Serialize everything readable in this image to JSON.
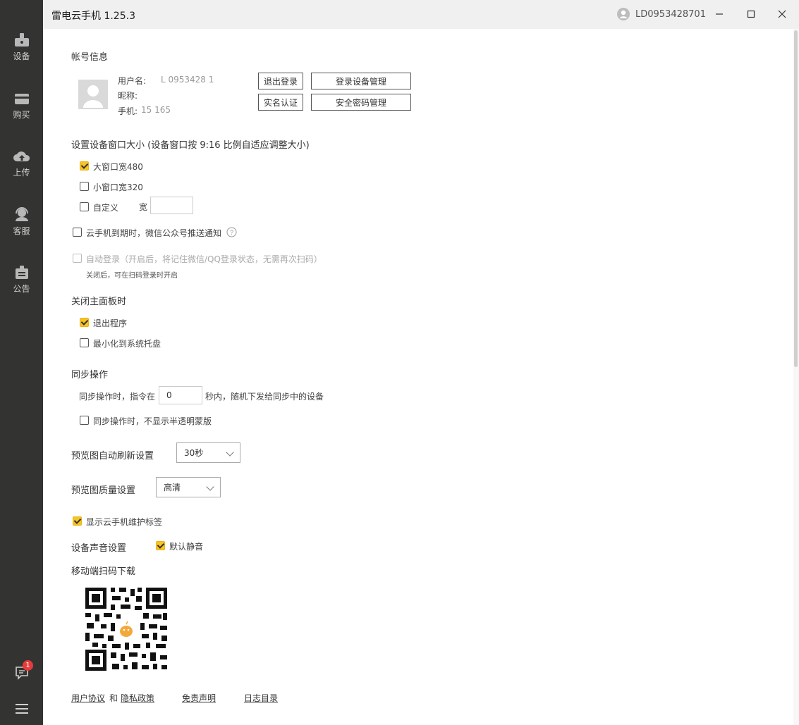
{
  "app": {
    "title": "雷电云手机 1.25.3",
    "user_id": "LD0953428701"
  },
  "nav": [
    {
      "label": "设备",
      "icon": "device-icon"
    },
    {
      "label": "购买",
      "icon": "card-icon"
    },
    {
      "label": "上传",
      "icon": "cloud-upload-icon"
    },
    {
      "label": "客服",
      "icon": "headset-icon"
    },
    {
      "label": "公告",
      "icon": "bulletin-icon"
    }
  ],
  "nav_bottom": {
    "badge": "1"
  },
  "account": {
    "section_title": "帐号信息",
    "username_label": "用户名:",
    "username_value": "L  0953428   1",
    "nickname_label": "昵称:",
    "phone_label": "手机:",
    "phone_value": "15          165",
    "logout": "退出登录",
    "device_mgmt": "登录设备管理",
    "realname": "实名认证",
    "password_mgmt": "安全密码管理"
  },
  "window_size": {
    "title": "设置设备窗口大小 (设备窗口按 9:16 比例自适应调整大小)",
    "large": "大窗口宽480",
    "small": "小窗口宽320",
    "custom": "自定义",
    "width_label": "宽",
    "width_value": ""
  },
  "wechat_notify": "云手机到期时，微信公众号推送通知",
  "auto_login": {
    "label": "自动登录（开启后，将记住微信/QQ登录状态，无需再次扫码）",
    "hint": "关闭后，可在扫码登录时开启"
  },
  "close_panel": {
    "title": "关闭主面板时",
    "exit": "退出程序",
    "minimize": "最小化到系统托盘"
  },
  "sync": {
    "title": "同步操作",
    "line_prefix": "同步操作时，指令在",
    "seconds": "0",
    "line_suffix": "秒内，随机下发给同步中的设备",
    "no_mask": "同步操作时，不显示半透明蒙版"
  },
  "preview_refresh": {
    "label": "预览图自动刷新设置",
    "value": "30秒"
  },
  "preview_quality": {
    "label": "预览图质量设置",
    "value": "高清"
  },
  "show_maintenance": "显示云手机维护标签",
  "sound": {
    "label": "设备声音设置",
    "mute": "默认静音"
  },
  "mobile_download": "移动端扫码下载",
  "footer": {
    "user_agreement": "用户协议",
    "and": "和",
    "privacy": "隐私政策",
    "disclaimer": "免责声明",
    "log_dir": "日志目录"
  },
  "colors": {
    "sidebar": "#333431",
    "accent": "#f7c325",
    "badge": "#e63b3b"
  }
}
